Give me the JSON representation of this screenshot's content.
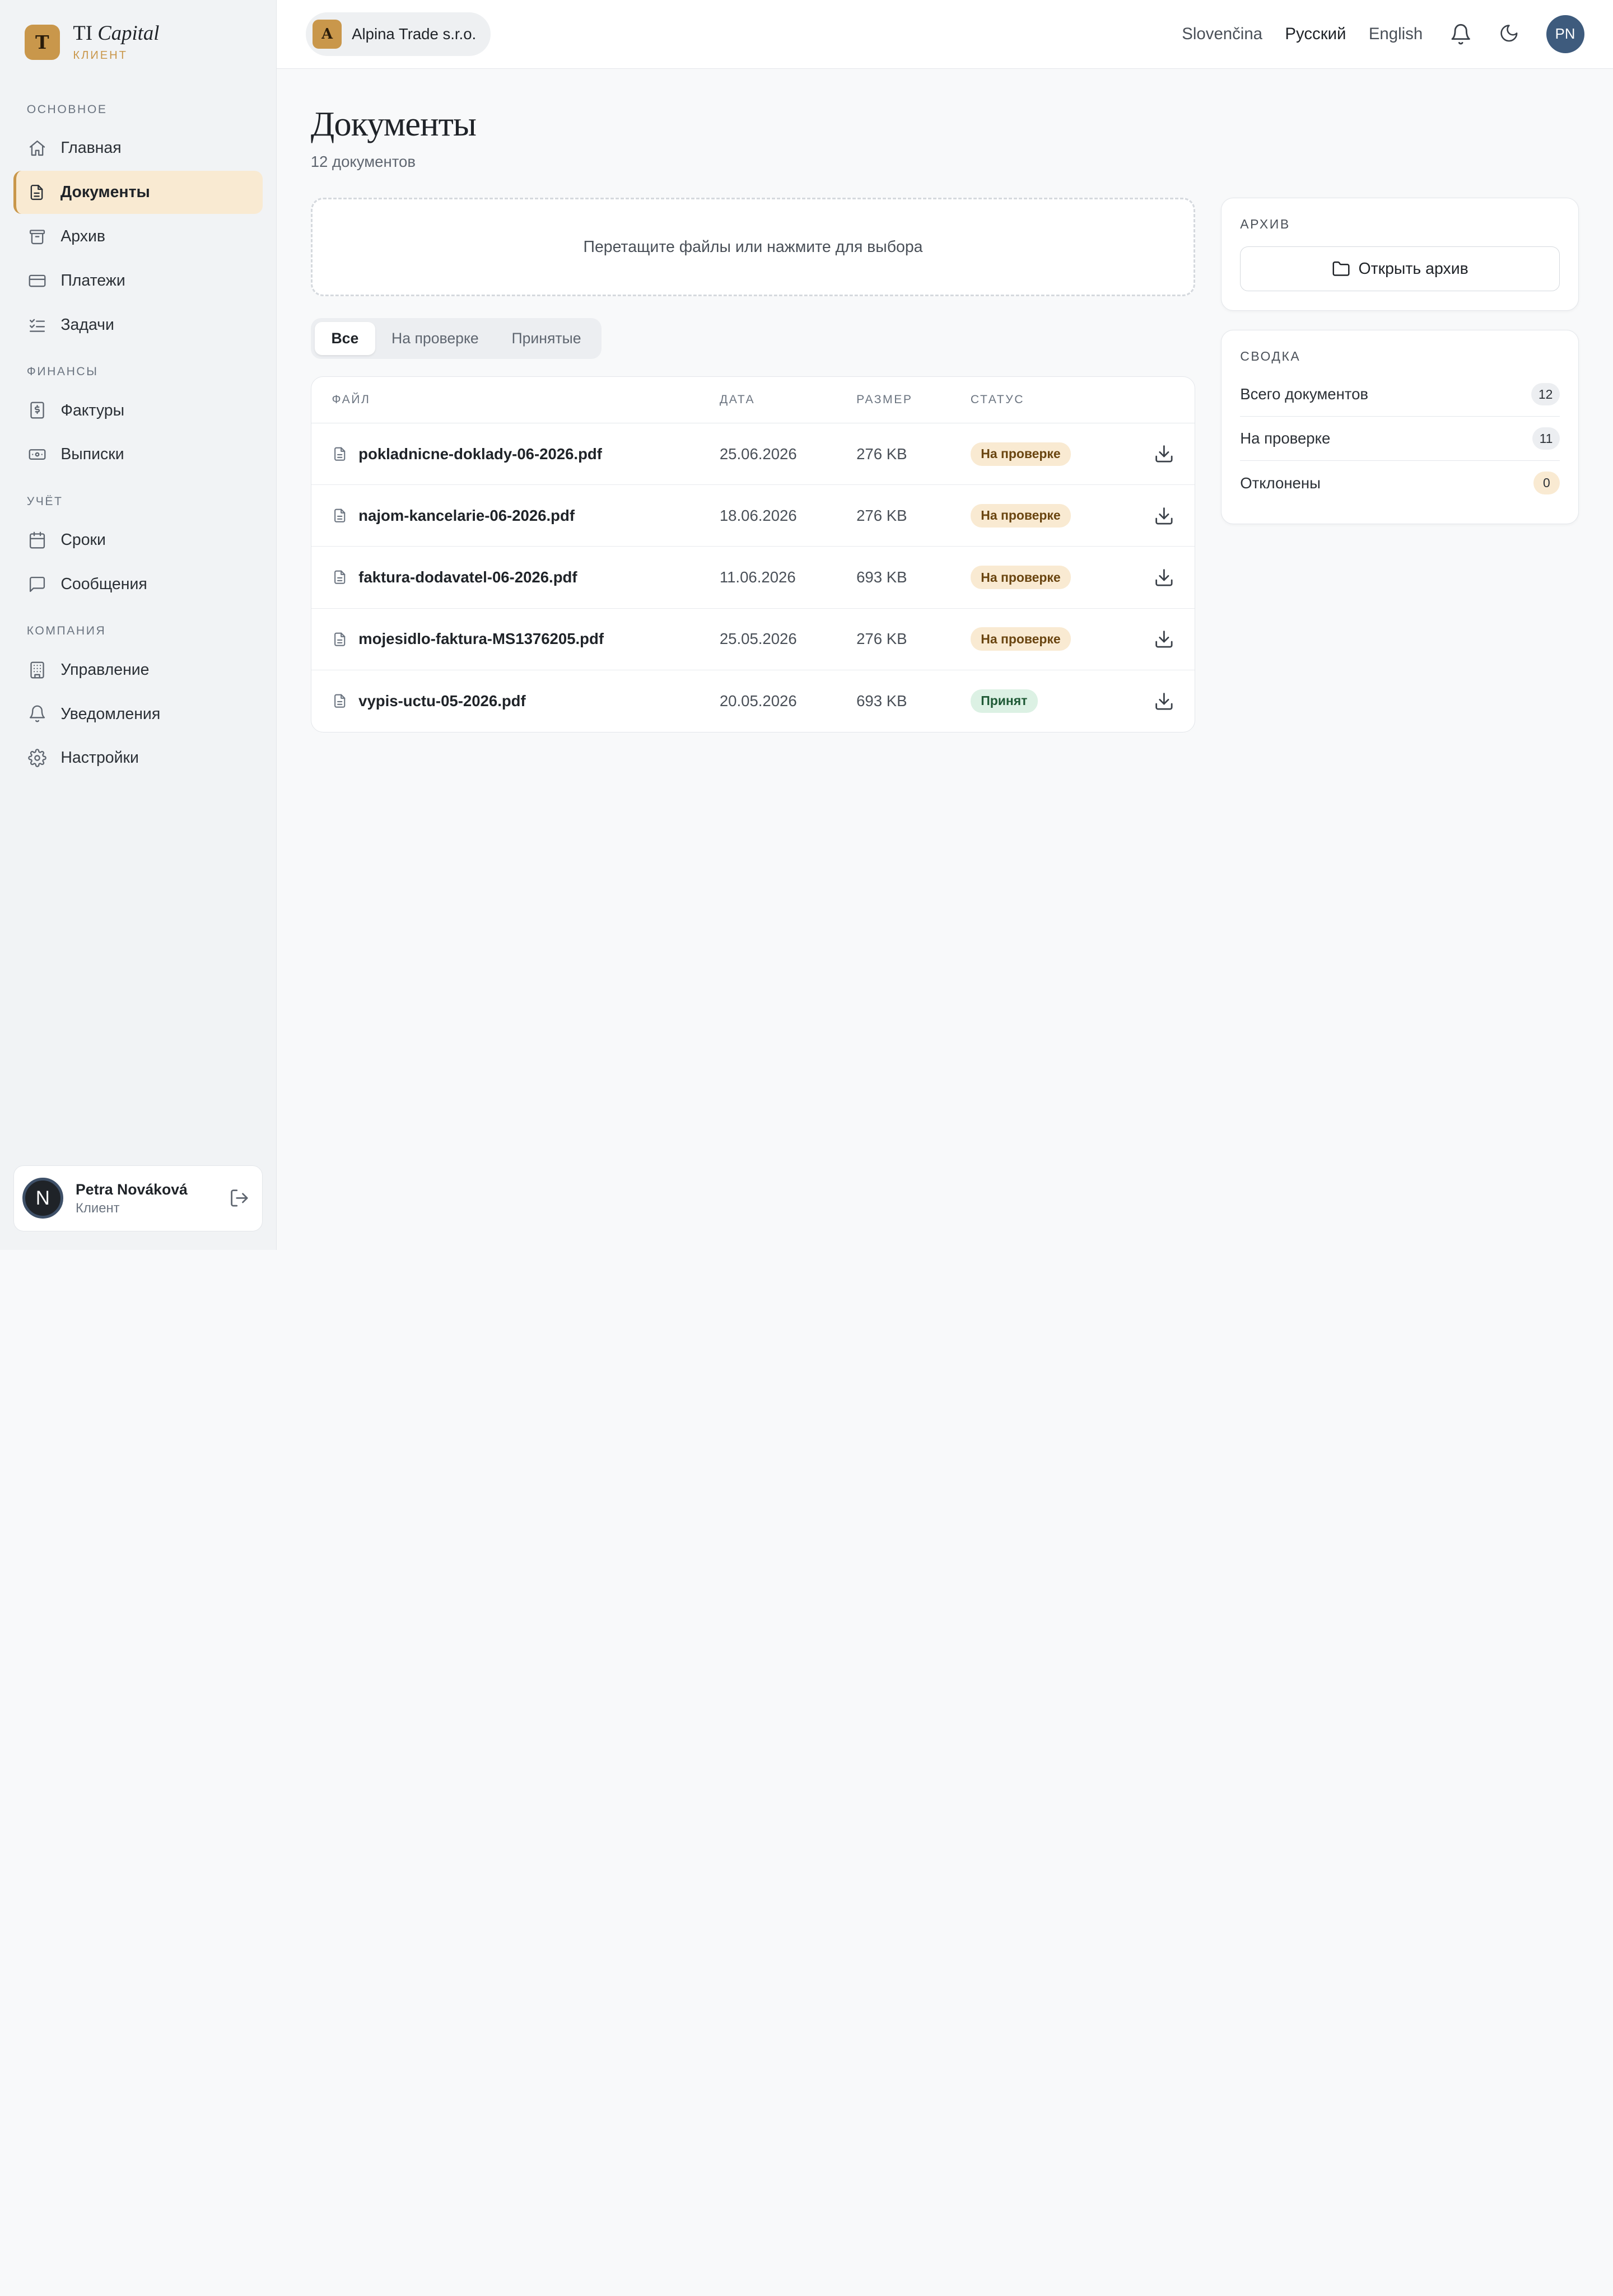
{
  "brand": {
    "logo_letter": "T",
    "title_plain": "TI",
    "title_italic": "Capital",
    "subtitle": "КЛИЕНТ"
  },
  "sidebar": {
    "sections": [
      {
        "label": "ОСНОВНОЕ",
        "items": [
          {
            "label": "Главная",
            "icon": "home-icon"
          },
          {
            "label": "Документы",
            "icon": "document-icon",
            "active": true
          },
          {
            "label": "Архив",
            "icon": "archive-icon"
          },
          {
            "label": "Платежи",
            "icon": "credit-card-icon"
          },
          {
            "label": "Задачи",
            "icon": "checklist-icon"
          }
        ]
      },
      {
        "label": "ФИНАНСЫ",
        "items": [
          {
            "label": "Фактуры",
            "icon": "invoice-icon"
          },
          {
            "label": "Выписки",
            "icon": "banknote-icon"
          }
        ]
      },
      {
        "label": "УЧЁТ",
        "items": [
          {
            "label": "Сроки",
            "icon": "calendar-icon"
          },
          {
            "label": "Сообщения",
            "icon": "message-icon"
          }
        ]
      },
      {
        "label": "КОМПАНИЯ",
        "items": [
          {
            "label": "Управление",
            "icon": "building-icon"
          },
          {
            "label": "Уведомления",
            "icon": "bell-icon"
          },
          {
            "label": "Настройки",
            "icon": "gear-icon"
          }
        ]
      }
    ]
  },
  "user": {
    "initial": "N",
    "name": "Petra Nováková",
    "role": "Клиент"
  },
  "topbar": {
    "company_letter": "A",
    "company_name": "Alpina Trade s.r.o.",
    "languages": [
      "Slovenčina",
      "Русский",
      "English"
    ],
    "active_language": "Русский",
    "avatar_initials": "PN"
  },
  "page": {
    "title": "Документы",
    "subtitle": "12 документов",
    "dropzone_text": "Перетащите файлы или нажмите для выбора",
    "filters": [
      "Все",
      "На проверке",
      "Принятые"
    ],
    "active_filter": "Все"
  },
  "table": {
    "headers": {
      "file": "ФАЙЛ",
      "date": "ДАТА",
      "size": "РАЗМЕР",
      "status": "СТАТУС"
    },
    "rows": [
      {
        "file": "pokladnicne-doklady-06-2026.pdf",
        "date": "25.06.2026",
        "size": "276 KB",
        "status": "На проверке",
        "status_type": "review"
      },
      {
        "file": "najom-kancelarie-06-2026.pdf",
        "date": "18.06.2026",
        "size": "276 KB",
        "status": "На проверке",
        "status_type": "review"
      },
      {
        "file": "faktura-dodavatel-06-2026.pdf",
        "date": "11.06.2026",
        "size": "693 KB",
        "status": "На проверке",
        "status_type": "review"
      },
      {
        "file": "mojesidlo-faktura-MS1376205.pdf",
        "date": "25.05.2026",
        "size": "276 KB",
        "status": "На проверке",
        "status_type": "review"
      },
      {
        "file": "vypis-uctu-05-2026.pdf",
        "date": "20.05.2026",
        "size": "693 KB",
        "status": "Принят",
        "status_type": "accepted"
      }
    ]
  },
  "archive_card": {
    "label": "АРХИВ",
    "button": "Открыть архив"
  },
  "summary_card": {
    "label": "СВОДКА",
    "stats": [
      {
        "label": "Всего документов",
        "count": "12"
      },
      {
        "label": "На проверке",
        "count": "11"
      },
      {
        "label": "Отклонены",
        "count": "0",
        "warn": true
      }
    ]
  },
  "colors": {
    "accent": "#c9974b",
    "accent_soft": "#f9ead2",
    "success_soft": "#dcf1e4",
    "avatar": "#3e5b7d"
  }
}
